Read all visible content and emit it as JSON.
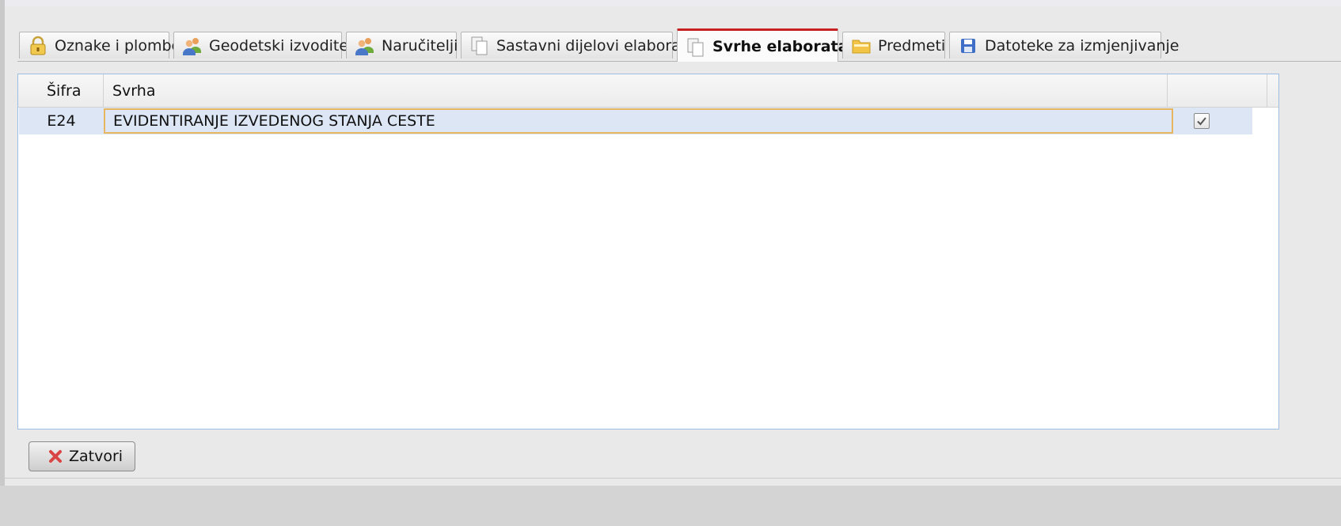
{
  "tabs": [
    {
      "label": "Oznake i plombe",
      "icon": "lock-icon"
    },
    {
      "label": "Geodetski izvoditelji",
      "icon": "users-icon"
    },
    {
      "label": "Naručitelji",
      "icon": "users-icon"
    },
    {
      "label": "Sastavni dijelovi elaborata",
      "icon": "documents-icon"
    },
    {
      "label": "Svrhe elaborata",
      "icon": "documents-icon",
      "active": true
    },
    {
      "label": "Predmeti",
      "icon": "folder-icon"
    },
    {
      "label": "Datoteke za izmjenjivanje",
      "icon": "floppy-disk-icon"
    }
  ],
  "grid": {
    "columns": [
      "Šifra",
      "Svrha",
      ""
    ],
    "rows": [
      {
        "code": "E24",
        "purpose": "EVIDENTIRANJE IZVEDENOG STANJA CESTE",
        "checked": true,
        "selected": true
      }
    ]
  },
  "footer": {
    "close_label": "Zatvori",
    "close_icon": "close-x-icon"
  },
  "colors": {
    "active_tab_accent": "#c62020",
    "selected_row": "#dce6f4",
    "cell_editor_border": "#e8b660",
    "grid_border": "#9ebde0",
    "close_icon": "#d94545"
  }
}
